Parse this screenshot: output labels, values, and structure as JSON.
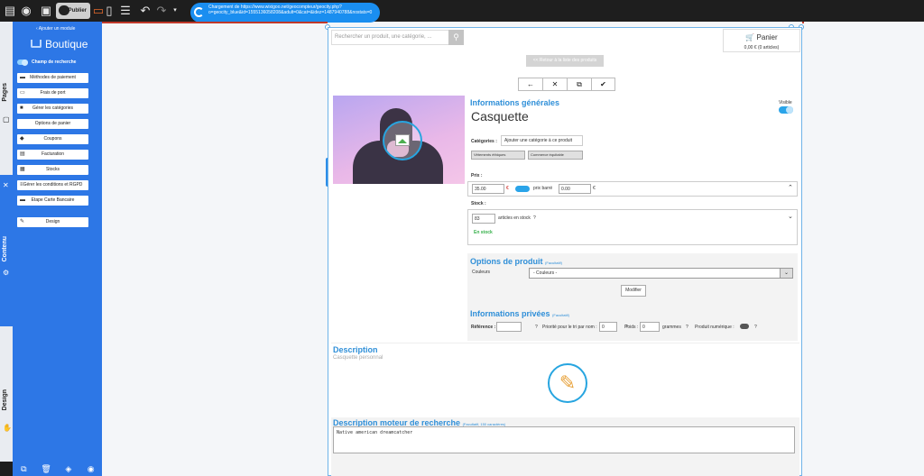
{
  "toolbar": {
    "publish_label": "Publier",
    "loading_message": "Chargement de https://www.wixigoo.net/geocompteur/geocity.php?o=geocity_blue&id=1555136058208&adult=0&cat=&idez=1487940788&nostats=0"
  },
  "rail": {
    "pages_label": "Pages",
    "content_label": "Contenu",
    "design_label": "Design"
  },
  "panel": {
    "back_label": "Ajouter un module",
    "title": "Boutique",
    "search_toggle_label": "Champ de recherche",
    "menu": [
      {
        "label": "Méthodes de paiement",
        "icon": "card-icon"
      },
      {
        "label": "Frais de port",
        "icon": "truck-icon"
      },
      {
        "label": "Gérer les catégories",
        "icon": "folder-icon"
      },
      {
        "label": "Options de panier",
        "icon": ""
      },
      {
        "label": "Coupons",
        "icon": "tag-icon"
      },
      {
        "label": "Facturation",
        "icon": "document-icon"
      },
      {
        "label": "Stocks",
        "icon": "boxes-icon"
      },
      {
        "label": "Gérer les conditions et RGPD",
        "icon": "list-icon"
      },
      {
        "label": "Etape Carte Bancaire",
        "icon": "card-icon"
      }
    ],
    "design_button": "Design"
  },
  "shop": {
    "search_placeholder": "Rechercher un produit, une catégorie, ...",
    "cart_title": "Panier",
    "cart_summary": "0,00 € (0 articles)",
    "back_to_list": "<< Retour à la liste des produits"
  },
  "product": {
    "general_heading": "Informations générales",
    "visible_label": "Visible",
    "name": "Casquette",
    "categories_label": "Catégories :",
    "add_category": "Ajouter une catégorie à ce produit",
    "tags": [
      "Vêtements éthiques",
      "Commerce équitable"
    ],
    "price_label": "Prix :",
    "price_value": "35.00",
    "currency": "€",
    "strike_label": "prix barré",
    "strike_value": "0.00",
    "strike_currency": "€",
    "stock_label": "Stock :",
    "stock_value": "83",
    "stock_unit": "articles en stock",
    "stock_status": "En stock",
    "options_heading": "Options de produit",
    "options_optional": "(Facultatif)",
    "color_label": "Couleurs",
    "color_select": "- Couleurs -",
    "modify_button": "Modifier",
    "private_heading": "Informations privées",
    "private_optional": "(Facultatif)",
    "reference_label": "Référence :",
    "priority_label": "Priorité pour le tri par nom :",
    "priority_value": "0",
    "weight_label": "Poids :",
    "weight_value": "0",
    "weight_unit": "grammes",
    "digital_label": "Produit numérique :",
    "description_heading": "Description",
    "description_text": "Casquette personnal",
    "seo_heading": "Description moteur de recherche",
    "seo_optional": "(Facultatif, 150 caractères)",
    "seo_text": "Native american dreamcatcher"
  }
}
